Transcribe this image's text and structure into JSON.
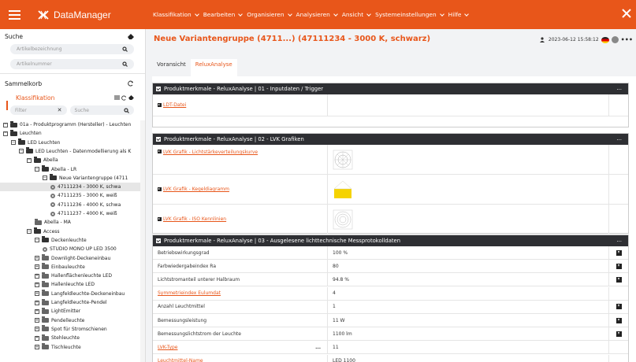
{
  "app": {
    "brand": "DataManager"
  },
  "menu": [
    {
      "label": "Klassifikation"
    },
    {
      "label": "Bearbeiten"
    },
    {
      "label": "Organisieren"
    },
    {
      "label": "Analysieren"
    },
    {
      "label": "Ansicht"
    },
    {
      "label": "Systemeinstellungen"
    },
    {
      "label": "Hilfe"
    }
  ],
  "sidebar": {
    "search_title": "Suche",
    "artikelbezeichnung_placeholder": "Artikelbezeichnung",
    "artikelnummer_placeholder": "Artikelnummer",
    "sammelkorb": "Sammelkorb",
    "klassifikation": "Klassifikation",
    "filter_placeholder": "Filter",
    "suche_placeholder": "Suche",
    "tree": [
      {
        "label": "01a - Produktprogramm (Hersteller) - Leuchten",
        "toggle": "-",
        "icon": "folder"
      },
      {
        "label": "Leuchten",
        "toggle": "-",
        "icon": "folder"
      },
      {
        "label": "LED Leuchten",
        "toggle": "-",
        "icon": "folder"
      },
      {
        "label": "LED Leuchten - Datenmodellierung als K",
        "toggle": "-",
        "icon": "folder"
      },
      {
        "label": "Abella",
        "toggle": "-",
        "icon": "folder"
      },
      {
        "label": "Abella - LR",
        "toggle": "-",
        "icon": "folder"
      },
      {
        "label": "Neue Variantengruppe (4711",
        "toggle": "-",
        "icon": "folder"
      },
      {
        "label": "47111234 - 3000 K, schwa",
        "toggle": "",
        "icon": "gear",
        "selected": true
      },
      {
        "label": "47111235 - 3000 K, weiß",
        "toggle": "",
        "icon": "gear"
      },
      {
        "label": "47111236 - 4000 K, schwa",
        "toggle": "",
        "icon": "gear"
      },
      {
        "label": "47111237 - 4000 K, weiß",
        "toggle": "",
        "icon": "gear"
      },
      {
        "label": "Abella - MA",
        "toggle": "",
        "icon": "folder-gray"
      },
      {
        "label": "Access",
        "toggle": "-",
        "icon": "folder"
      },
      {
        "label": "Deckenleuchte",
        "toggle": "-",
        "icon": "folder"
      },
      {
        "label": "STUDIO MONO UP LED 3500",
        "toggle": "",
        "icon": "gear"
      },
      {
        "label": "Downlight-Deckeneinbau",
        "toggle": "+",
        "icon": "folder-gray"
      },
      {
        "label": "Einbauleuchte",
        "toggle": "+",
        "icon": "folder-gray"
      },
      {
        "label": "Hallenflächenleuchte LED",
        "toggle": "+",
        "icon": "folder-gray"
      },
      {
        "label": "Hallenleuchte LED",
        "toggle": "+",
        "icon": "folder-gray"
      },
      {
        "label": "Langfeldleuchte-Deckeneinbau",
        "toggle": "+",
        "icon": "folder-gray"
      },
      {
        "label": "Langfeldleuchte-Pendel",
        "toggle": "+",
        "icon": "folder-gray"
      },
      {
        "label": "LightEmitter",
        "toggle": "+",
        "icon": "folder-gray"
      },
      {
        "label": "Pendelleuchte",
        "toggle": "+",
        "icon": "folder-gray"
      },
      {
        "label": "Spot für Stromschienen",
        "toggle": "+",
        "icon": "folder-gray"
      },
      {
        "label": "Stehleuchte",
        "toggle": "+",
        "icon": "folder-gray"
      },
      {
        "label": "Tischleuchte",
        "toggle": "+",
        "icon": "folder-gray"
      }
    ]
  },
  "main": {
    "title": "Neue Variantengruppe (4711...) (47111234 - 3000 K, schwarz)",
    "timestamp": "2023-06-12 15:58:12",
    "more": "•••",
    "tabs": [
      {
        "label": "Voransicht"
      },
      {
        "label": "ReluxAnalyse"
      }
    ],
    "panel1": {
      "title": "Produktmerkmale - ReluxAnalyse | 01 - Inputdaten / Trigger",
      "menu": "...",
      "rows": [
        {
          "label": "LDT-Datei"
        }
      ]
    },
    "panel2": {
      "title": "Produktmerkmale - ReluxAnalyse | 02 - LVK Grafiken",
      "menu": "...",
      "rows": [
        {
          "label": "LVK Grafik - Lichtstärkeverteilungskurve"
        },
        {
          "label": "LVK Grafik - Kegeldiagramm"
        },
        {
          "label": "LVK Grafik - ISO Kennlinien"
        }
      ]
    },
    "panel3": {
      "title": "Produktmerkmale - ReluxAnalyse | 03 - Ausgelesene lichttechnische Messprotokolldaten",
      "menu": "...",
      "rows": [
        {
          "label": "Betriebswirkungsgrad",
          "value": "100 %"
        },
        {
          "label": "Farbwiedergabeindex Ra",
          "value": "80"
        },
        {
          "label": "Lichtstromanteil unterer Halbraum",
          "value": "94.8 %"
        },
        {
          "label": "Symmetrieindex Eulumdat",
          "value": "4"
        },
        {
          "label": "Anzahl Leuchtmittel",
          "value": "1"
        },
        {
          "label": "Bemessungsleistung",
          "value": "11 W"
        },
        {
          "label": "Bemessungslichtstrom der Leuchte",
          "value": "1100 lm"
        },
        {
          "label": "LVK-Type",
          "value": "11",
          "extra": "..."
        },
        {
          "label": "Leuchtmittel-Name",
          "value": "LED 1100"
        }
      ]
    }
  },
  "colors": {
    "accent": "#e8561a",
    "panel_head": "#2e2f33",
    "bg": "#f2f3f5"
  }
}
